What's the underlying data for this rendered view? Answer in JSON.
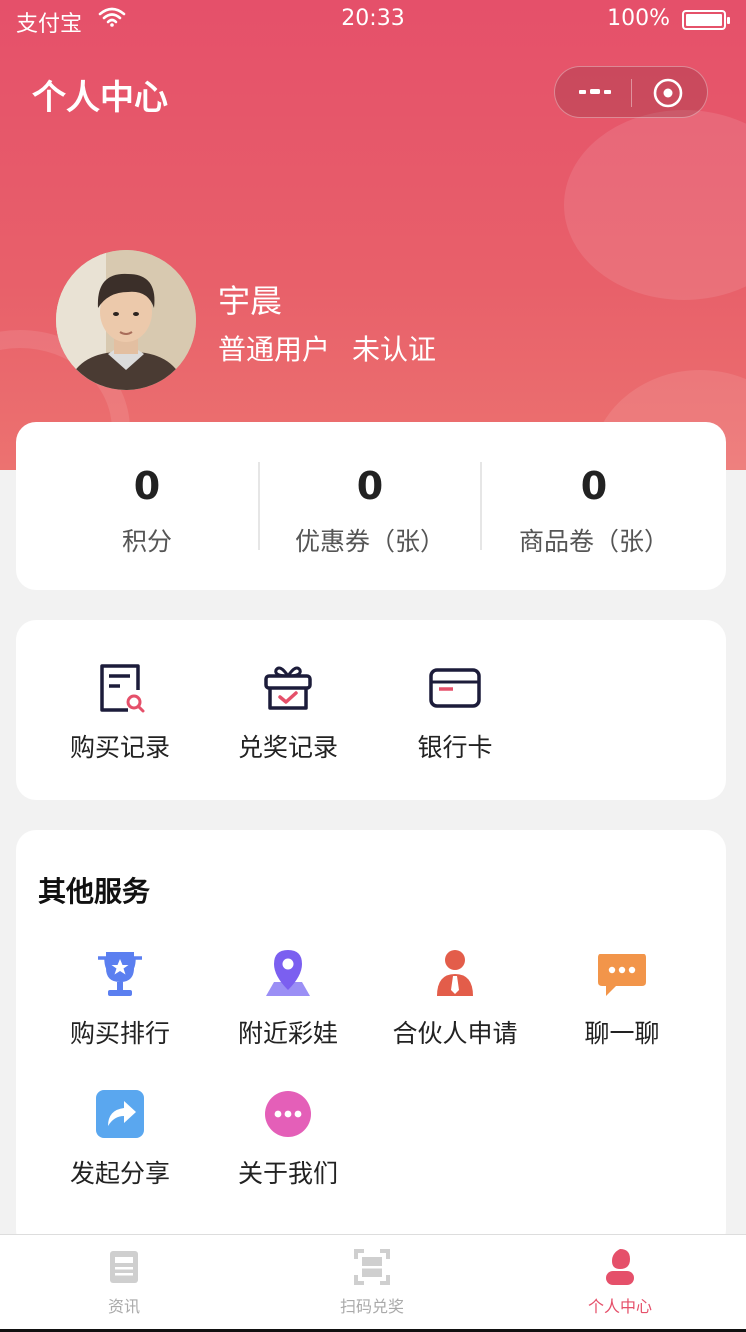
{
  "status_bar": {
    "carrier": "支付宝",
    "time": "20:33",
    "battery": "100%"
  },
  "header": {
    "title": "个人中心"
  },
  "user": {
    "name": "宇晨",
    "level": "普通用户",
    "verification": "未认证"
  },
  "stats": [
    {
      "value": "0",
      "label": "积分"
    },
    {
      "value": "0",
      "label": "优惠券（张）"
    },
    {
      "value": "0",
      "label": "商品卷（张）"
    }
  ],
  "records": [
    {
      "label": "购买记录",
      "icon": "purchase-record-icon"
    },
    {
      "label": "兑奖记录",
      "icon": "gift-record-icon"
    },
    {
      "label": "银行卡",
      "icon": "bank-card-icon"
    }
  ],
  "services": {
    "heading": "其他服务",
    "items": [
      {
        "label": "购买排行",
        "icon": "trophy-icon"
      },
      {
        "label": "附近彩娃",
        "icon": "location-pin-icon"
      },
      {
        "label": "合伙人申请",
        "icon": "partner-icon"
      },
      {
        "label": "聊一聊",
        "icon": "chat-bubble-icon"
      },
      {
        "label": "发起分享",
        "icon": "share-icon"
      },
      {
        "label": "关于我们",
        "icon": "more-dots-icon"
      }
    ]
  },
  "tabbar": [
    {
      "label": "资讯",
      "icon": "news-icon",
      "active": false
    },
    {
      "label": "扫码兑奖",
      "icon": "scan-icon",
      "active": false
    },
    {
      "label": "个人中心",
      "icon": "profile-icon",
      "active": true
    }
  ],
  "colors": {
    "accent": "#e5506a",
    "background": "#f2f2f2"
  }
}
